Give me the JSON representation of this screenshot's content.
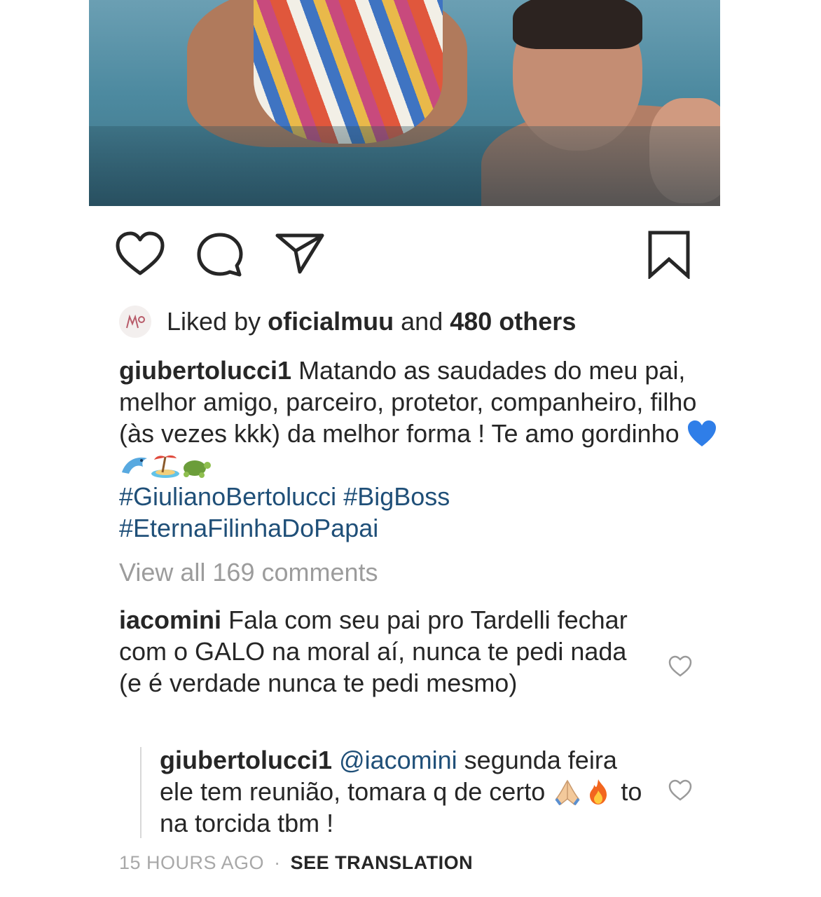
{
  "post": {
    "image_alt": "",
    "colors": {
      "link": "#1f4f78",
      "muted": "#9c9c9c",
      "text": "#262626"
    }
  },
  "actions": {
    "like_icon": "heart-icon",
    "comment_icon": "comment-icon",
    "share_icon": "send-icon",
    "save_icon": "bookmark-icon"
  },
  "likes": {
    "prefix": "Liked by",
    "user": "oficialmuu",
    "connector": "and",
    "others": "480 others"
  },
  "caption": {
    "username": "giubertolucci1",
    "text": "Matando as saudades do meu pai, melhor amigo, parceiro, protetor, companheiro, filho (às vezes kkk) da melhor forma ! Te amo gordinho",
    "emojis": [
      "blue-heart-icon",
      "dolphin-icon",
      "island-icon",
      "turtle-icon"
    ],
    "hashtags": [
      "#GiulianoBertolucci",
      "#BigBoss",
      "#EternaFilinhaDoPapai"
    ]
  },
  "view_all_comments": "View all 169 comments",
  "comments": [
    {
      "username": "iacomini",
      "text": "Fala com seu pai pro Tardelli fechar com o GALO na moral aí, nunca te pedi nada (e é verdade nunca te pedi mesmo)"
    },
    {
      "username": "giubertolucci1",
      "mention": "@iacomini",
      "text_before": "segunda feira ele tem reunião, tomara q de certo",
      "emojis": [
        "folded-hands-icon",
        "fire-icon"
      ],
      "text_after": "to na torcida tbm !"
    }
  ],
  "meta": {
    "time": "15 HOURS AGO",
    "separator": "·",
    "translate": "SEE TRANSLATION"
  }
}
